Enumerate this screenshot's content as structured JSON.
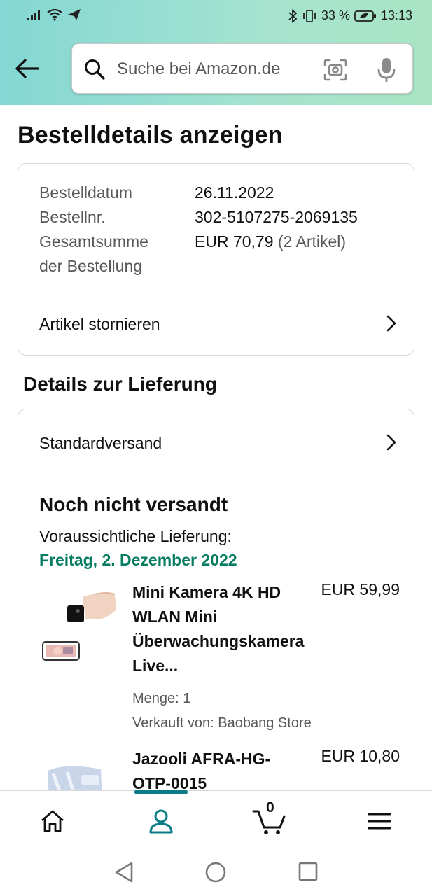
{
  "status_bar": {
    "battery": "33 %",
    "time": "13:13"
  },
  "search": {
    "placeholder": "Suche bei Amazon.de"
  },
  "page": {
    "title": "Bestelldetails anzeigen"
  },
  "order": {
    "date_label": "Bestelldatum",
    "date_value": "26.11.2022",
    "number_label": "Bestellnr.",
    "number_value": "302-5107275-2069135",
    "total_label_1": "Gesamtsumme",
    "total_label_2": "der Bestellung",
    "total_value": "EUR 70,79",
    "total_items": "(2 Artikel)",
    "cancel_label": "Artikel stornieren"
  },
  "delivery": {
    "section_title": "Details zur Lieferung",
    "shipping_method": "Standardversand",
    "status": "Noch nicht versandt",
    "estimate_label": "Voraussichtliche Lieferung:",
    "estimate_date": "Freitag, 2. Dezember 2022",
    "items": [
      {
        "title_lines": [
          "Mini Kamera 4K HD",
          "WLAN Mini",
          "Überwachungskamera",
          "Live..."
        ],
        "price": "EUR 59,99",
        "quantity": "Menge: 1",
        "seller": "Verkauft von: Baobang Store"
      },
      {
        "title_lines": [
          "Jazooli AFRA-HG-",
          "OTP-0015"
        ],
        "price": "EUR 10,80"
      }
    ]
  },
  "bottom_nav": {
    "cart_count": "0",
    "active_tab": "account"
  },
  "colors": {
    "accent_teal": "#0a7c86",
    "delivery_green": "#067d62",
    "header_gradient_start": "#84d7d4",
    "header_gradient_end": "#a9e4c4"
  }
}
